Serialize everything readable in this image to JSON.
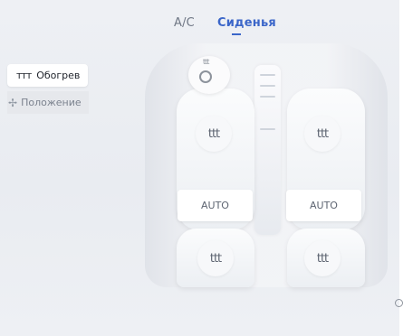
{
  "tabs": [
    {
      "label": "A/C"
    },
    {
      "label": "Сиденья"
    }
  ],
  "left_menu": {
    "heat_label": "Обогрев",
    "position_label": "Положение",
    "heat_icon": "seat-heat-icon",
    "position_icon": "move-arrows-icon"
  },
  "seats": {
    "front_left": {
      "heat_icon": "ttt",
      "auto_label": "AUTO"
    },
    "front_right": {
      "heat_icon": "ttt",
      "auto_label": "AUTO"
    },
    "rear_left": {
      "heat_icon": "ttt"
    },
    "rear_right": {
      "heat_icon": "ttt"
    }
  },
  "steering": {
    "heat_icon": "ttt"
  },
  "colors": {
    "accent": "#3b66c9",
    "background": "#eef0f4",
    "text_dark": "#1f232b",
    "text_muted": "#7b828e"
  }
}
